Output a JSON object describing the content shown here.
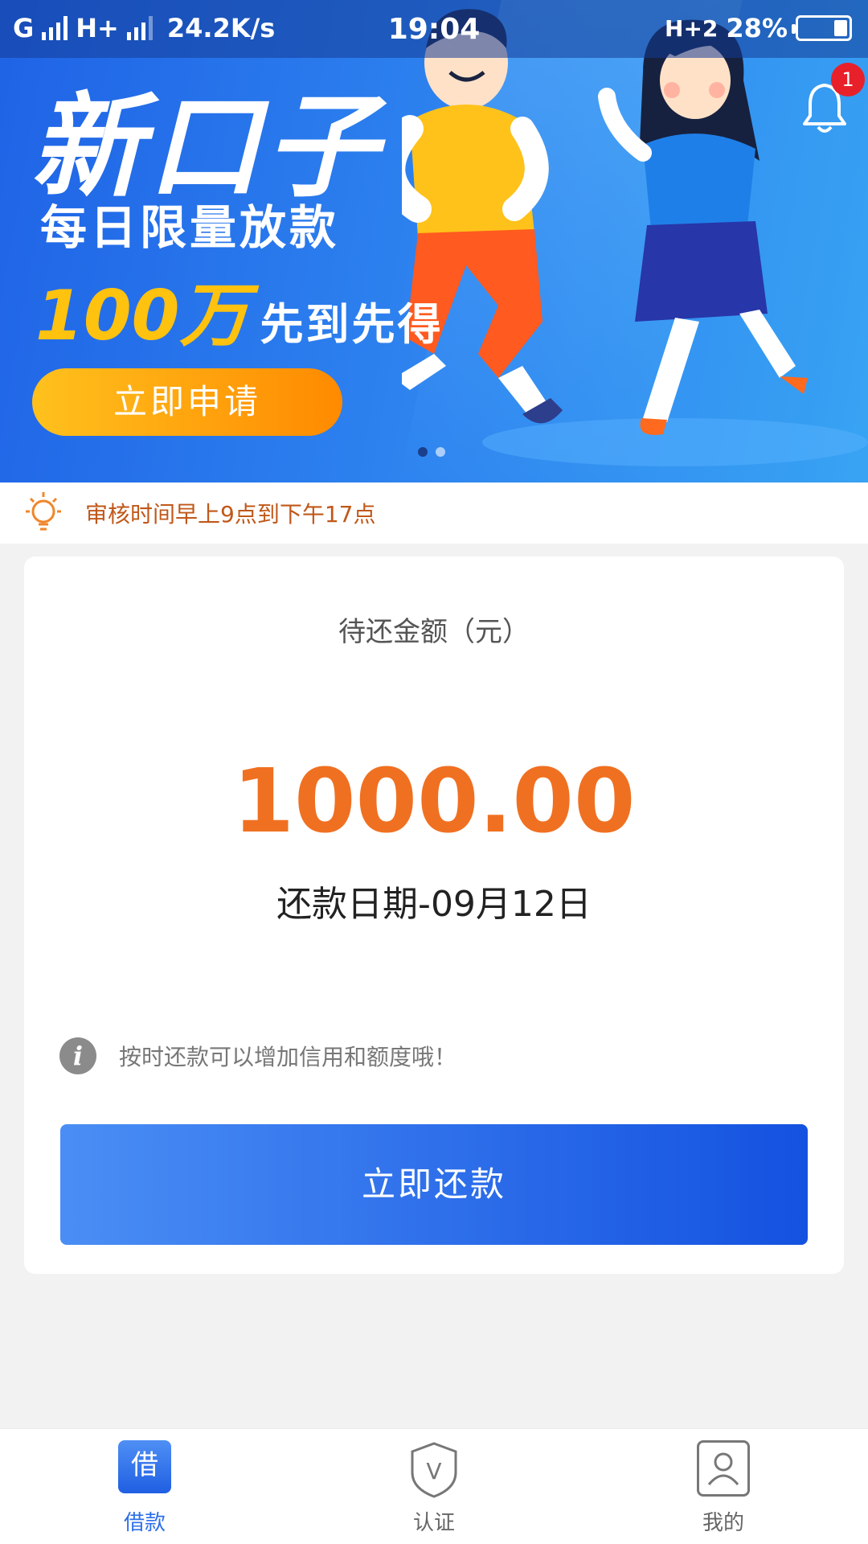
{
  "status_bar": {
    "carrier1": "G",
    "carrier2": "H+",
    "speed": "24.2K/s",
    "time": "19:04",
    "network_right": "H+2",
    "battery": "28%"
  },
  "banner": {
    "title": "新口子",
    "subtitle": "每日限量放款",
    "amount": "100万",
    "amount_suffix": "先到先得",
    "apply_label": "立即申请",
    "slide_count": 2,
    "active_slide": 1,
    "notification_count": "1"
  },
  "notice": {
    "text": "审核时间早上9点到下午17点"
  },
  "repayment": {
    "label": "待还金额（元）",
    "amount": "1000.00",
    "due_date": "还款日期-09月12日",
    "tip": "按时还款可以增加信用和额度哦！",
    "button_label": "立即还款"
  },
  "tabs": [
    {
      "label": "借款",
      "icon": "loan-icon",
      "icon_text": "借",
      "active": true
    },
    {
      "label": "认证",
      "icon": "shield-v-icon",
      "icon_text": "V",
      "active": false
    },
    {
      "label": "我的",
      "icon": "user-icon",
      "active": false
    }
  ],
  "colors": {
    "primary_blue": "#2d6fe8",
    "amount_orange": "#f07021",
    "apply_gradient_start": "#ffc11d",
    "apply_gradient_end": "#ff8a00",
    "badge_red": "#e8202a"
  }
}
